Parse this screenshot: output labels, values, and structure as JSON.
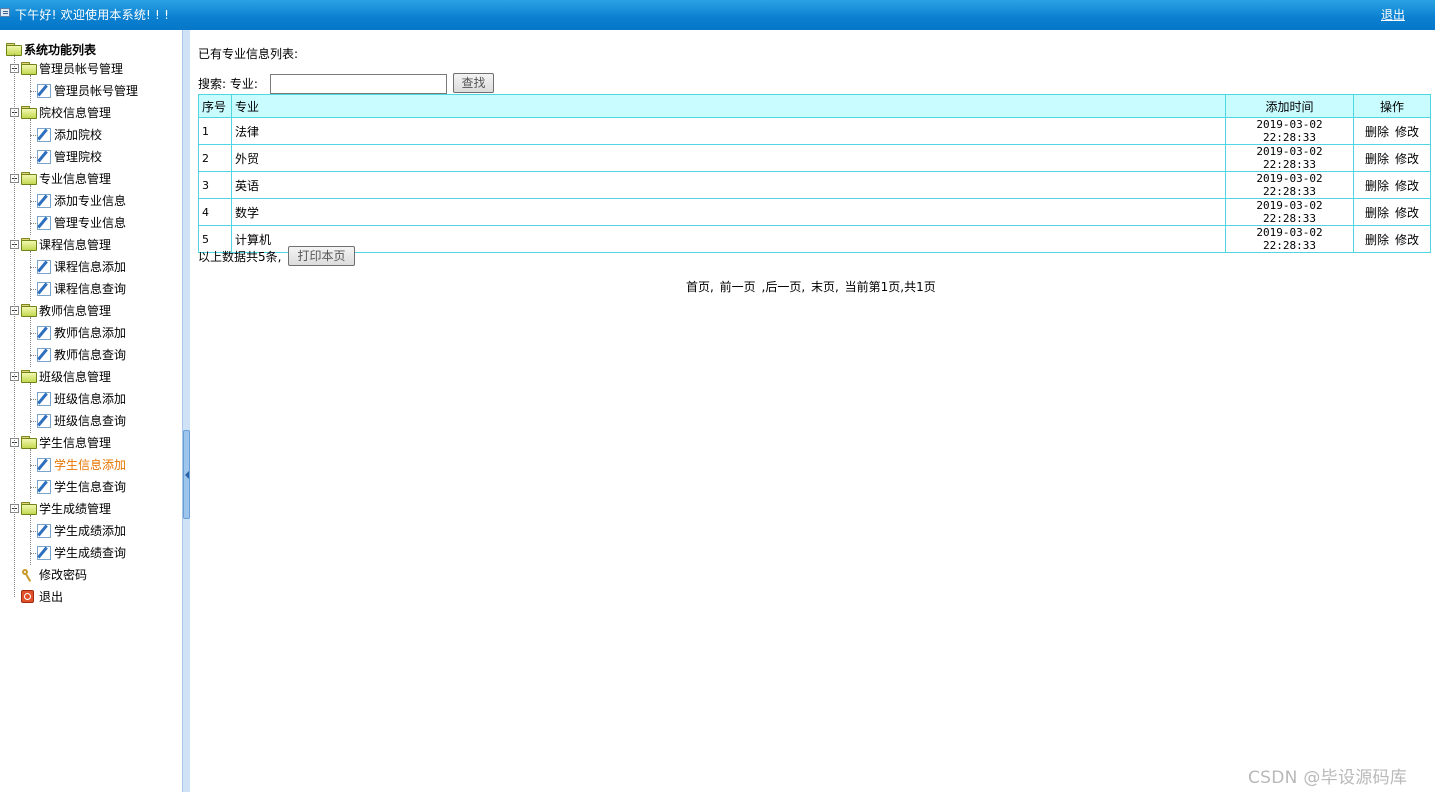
{
  "topbar": {
    "greeting": "下午好! 欢迎使用本系统! ! !",
    "logout_label": "退出"
  },
  "sidebar": {
    "root_label": "系统功能列表",
    "groups": [
      {
        "label": "管理员帐号管理",
        "items": [
          "管理员帐号管理"
        ]
      },
      {
        "label": "院校信息管理",
        "items": [
          "添加院校",
          "管理院校"
        ]
      },
      {
        "label": "专业信息管理",
        "items": [
          "添加专业信息",
          "管理专业信息"
        ]
      },
      {
        "label": "课程信息管理",
        "items": [
          "课程信息添加",
          "课程信息查询"
        ]
      },
      {
        "label": "教师信息管理",
        "items": [
          "教师信息添加",
          "教师信息查询"
        ]
      },
      {
        "label": "班级信息管理",
        "items": [
          "班级信息添加",
          "班级信息查询"
        ]
      },
      {
        "label": "学生信息管理",
        "items": [
          "学生信息添加",
          "学生信息查询"
        ]
      },
      {
        "label": "学生成绩管理",
        "items": [
          "学生成绩添加",
          "学生成绩查询"
        ]
      }
    ],
    "active_item": "学生信息添加",
    "extra": {
      "change_password": "修改密码",
      "logout": "退出"
    }
  },
  "main": {
    "list_title": "已有专业信息列表:",
    "search": {
      "label": "搜索: 专业:",
      "value": "",
      "button": "查找"
    },
    "table": {
      "headers": [
        "序号",
        "专业",
        "添加时间",
        "操作"
      ],
      "rows": [
        {
          "no": "1",
          "major": "法律",
          "time": "2019-03-02 22:28:33"
        },
        {
          "no": "2",
          "major": "外贸",
          "time": "2019-03-02 22:28:33"
        },
        {
          "no": "3",
          "major": "英语",
          "time": "2019-03-02 22:28:33"
        },
        {
          "no": "4",
          "major": "数学",
          "time": "2019-03-02 22:28:33"
        },
        {
          "no": "5",
          "major": "计算机",
          "time": "2019-03-02 22:28:33"
        }
      ],
      "actions": [
        "删除",
        "修改"
      ]
    },
    "summary": "以上数据共5条,",
    "print_button": "打印本页",
    "pager": {
      "first": "首页,",
      "prev": "前一页",
      "next": ",后一页,",
      "last": "末页,",
      "status": "当前第1页,共1页"
    }
  },
  "watermark": "CSDN @毕设源码库",
  "colors": {
    "topbar": "#0a7fd0",
    "table_border": "#4fd6e0",
    "table_header": "#c8fcff",
    "active_link": "#e87400"
  }
}
